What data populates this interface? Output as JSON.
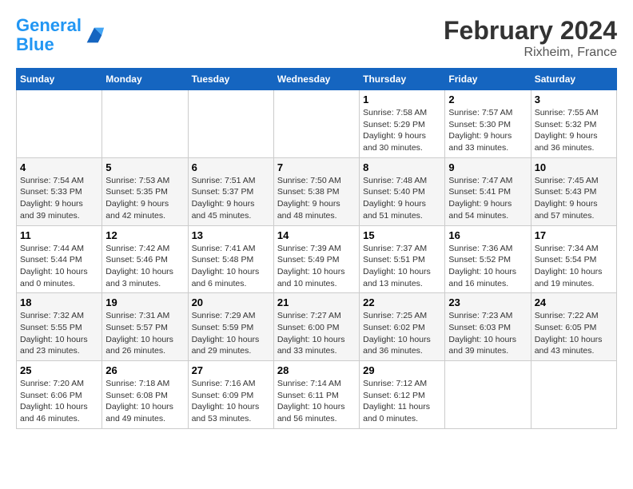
{
  "header": {
    "logo_line1": "General",
    "logo_line2": "Blue",
    "title": "February 2024",
    "subtitle": "Rixheim, France"
  },
  "weekdays": [
    "Sunday",
    "Monday",
    "Tuesday",
    "Wednesday",
    "Thursday",
    "Friday",
    "Saturday"
  ],
  "weeks": [
    [
      {
        "day": "",
        "info": ""
      },
      {
        "day": "",
        "info": ""
      },
      {
        "day": "",
        "info": ""
      },
      {
        "day": "",
        "info": ""
      },
      {
        "day": "1",
        "info": "Sunrise: 7:58 AM\nSunset: 5:29 PM\nDaylight: 9 hours\nand 30 minutes."
      },
      {
        "day": "2",
        "info": "Sunrise: 7:57 AM\nSunset: 5:30 PM\nDaylight: 9 hours\nand 33 minutes."
      },
      {
        "day": "3",
        "info": "Sunrise: 7:55 AM\nSunset: 5:32 PM\nDaylight: 9 hours\nand 36 minutes."
      }
    ],
    [
      {
        "day": "4",
        "info": "Sunrise: 7:54 AM\nSunset: 5:33 PM\nDaylight: 9 hours\nand 39 minutes."
      },
      {
        "day": "5",
        "info": "Sunrise: 7:53 AM\nSunset: 5:35 PM\nDaylight: 9 hours\nand 42 minutes."
      },
      {
        "day": "6",
        "info": "Sunrise: 7:51 AM\nSunset: 5:37 PM\nDaylight: 9 hours\nand 45 minutes."
      },
      {
        "day": "7",
        "info": "Sunrise: 7:50 AM\nSunset: 5:38 PM\nDaylight: 9 hours\nand 48 minutes."
      },
      {
        "day": "8",
        "info": "Sunrise: 7:48 AM\nSunset: 5:40 PM\nDaylight: 9 hours\nand 51 minutes."
      },
      {
        "day": "9",
        "info": "Sunrise: 7:47 AM\nSunset: 5:41 PM\nDaylight: 9 hours\nand 54 minutes."
      },
      {
        "day": "10",
        "info": "Sunrise: 7:45 AM\nSunset: 5:43 PM\nDaylight: 9 hours\nand 57 minutes."
      }
    ],
    [
      {
        "day": "11",
        "info": "Sunrise: 7:44 AM\nSunset: 5:44 PM\nDaylight: 10 hours\nand 0 minutes."
      },
      {
        "day": "12",
        "info": "Sunrise: 7:42 AM\nSunset: 5:46 PM\nDaylight: 10 hours\nand 3 minutes."
      },
      {
        "day": "13",
        "info": "Sunrise: 7:41 AM\nSunset: 5:48 PM\nDaylight: 10 hours\nand 6 minutes."
      },
      {
        "day": "14",
        "info": "Sunrise: 7:39 AM\nSunset: 5:49 PM\nDaylight: 10 hours\nand 10 minutes."
      },
      {
        "day": "15",
        "info": "Sunrise: 7:37 AM\nSunset: 5:51 PM\nDaylight: 10 hours\nand 13 minutes."
      },
      {
        "day": "16",
        "info": "Sunrise: 7:36 AM\nSunset: 5:52 PM\nDaylight: 10 hours\nand 16 minutes."
      },
      {
        "day": "17",
        "info": "Sunrise: 7:34 AM\nSunset: 5:54 PM\nDaylight: 10 hours\nand 19 minutes."
      }
    ],
    [
      {
        "day": "18",
        "info": "Sunrise: 7:32 AM\nSunset: 5:55 PM\nDaylight: 10 hours\nand 23 minutes."
      },
      {
        "day": "19",
        "info": "Sunrise: 7:31 AM\nSunset: 5:57 PM\nDaylight: 10 hours\nand 26 minutes."
      },
      {
        "day": "20",
        "info": "Sunrise: 7:29 AM\nSunset: 5:59 PM\nDaylight: 10 hours\nand 29 minutes."
      },
      {
        "day": "21",
        "info": "Sunrise: 7:27 AM\nSunset: 6:00 PM\nDaylight: 10 hours\nand 33 minutes."
      },
      {
        "day": "22",
        "info": "Sunrise: 7:25 AM\nSunset: 6:02 PM\nDaylight: 10 hours\nand 36 minutes."
      },
      {
        "day": "23",
        "info": "Sunrise: 7:23 AM\nSunset: 6:03 PM\nDaylight: 10 hours\nand 39 minutes."
      },
      {
        "day": "24",
        "info": "Sunrise: 7:22 AM\nSunset: 6:05 PM\nDaylight: 10 hours\nand 43 minutes."
      }
    ],
    [
      {
        "day": "25",
        "info": "Sunrise: 7:20 AM\nSunset: 6:06 PM\nDaylight: 10 hours\nand 46 minutes."
      },
      {
        "day": "26",
        "info": "Sunrise: 7:18 AM\nSunset: 6:08 PM\nDaylight: 10 hours\nand 49 minutes."
      },
      {
        "day": "27",
        "info": "Sunrise: 7:16 AM\nSunset: 6:09 PM\nDaylight: 10 hours\nand 53 minutes."
      },
      {
        "day": "28",
        "info": "Sunrise: 7:14 AM\nSunset: 6:11 PM\nDaylight: 10 hours\nand 56 minutes."
      },
      {
        "day": "29",
        "info": "Sunrise: 7:12 AM\nSunset: 6:12 PM\nDaylight: 11 hours\nand 0 minutes."
      },
      {
        "day": "",
        "info": ""
      },
      {
        "day": "",
        "info": ""
      }
    ]
  ]
}
